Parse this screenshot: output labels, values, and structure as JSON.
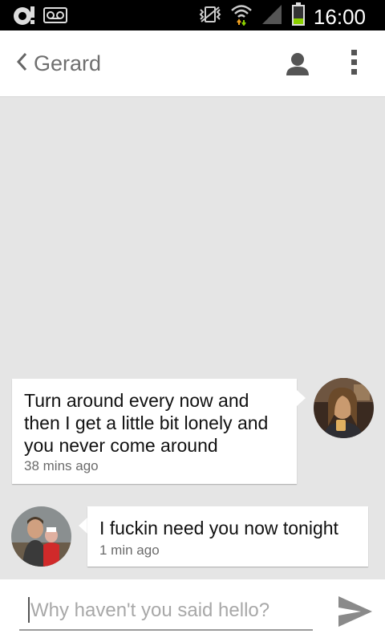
{
  "status_bar": {
    "time": "16:00",
    "icons": [
      "notification-icon",
      "voicemail-icon",
      "vibrate-icon",
      "wifi-icon",
      "signal-icon",
      "battery-icon"
    ]
  },
  "action_bar": {
    "contact_name": "Gerard",
    "icons": [
      "back-chevron-icon",
      "person-icon",
      "overflow-menu-icon"
    ]
  },
  "messages": [
    {
      "direction": "outgoing",
      "text": "Turn around every now and then I get a little bit lonely and you never come around",
      "time": "38 mins ago"
    },
    {
      "direction": "incoming",
      "text": "I fuckin need you now tonight",
      "time": "1 min ago"
    }
  ],
  "compose": {
    "placeholder": "Why haven't you said hello?",
    "value": "",
    "send_icon": "send-icon"
  },
  "colors": {
    "status_bar_bg": "#000000",
    "action_bar_bg": "#ffffff",
    "chat_bg": "#e5e5e5",
    "bubble_bg": "#ffffff",
    "battery_level": "#8bd000",
    "wifi_arrows": "#f0a020"
  }
}
